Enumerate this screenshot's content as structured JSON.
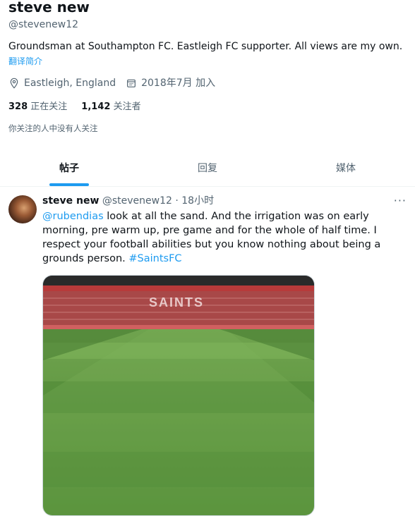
{
  "profile": {
    "display_name": "steve new",
    "handle": "@stevenew12",
    "bio": "Groundsman at Southampton FC. Eastleigh FC supporter. All views are my own.",
    "translate_bio": "翻译简介",
    "location": "Eastleigh, England",
    "joined": "2018年7月 加入",
    "following_count": "328",
    "following_label": "正在关注",
    "followers_count": "1,142",
    "followers_label": "关注者",
    "followers_you_know": "你关注的人中没有人关注"
  },
  "tabs": [
    {
      "label": "帖子",
      "active": true
    },
    {
      "label": "回复",
      "active": false
    },
    {
      "label": "媒体",
      "active": false
    }
  ],
  "tweet": {
    "name": "steve new",
    "handle_time": "@stevenew12 · 18小时",
    "more": "···",
    "mention": "@rubendias",
    "text": " look at all the sand. And the irrigation was on early morning, pre warm up, pre game and for the whole of half time. I respect your football abilities but you know nothing about being a grounds person.",
    "hashtag": "#SaintsFC",
    "stand_lettering": "SAINTS"
  },
  "colors": {
    "accent": "#1d9bf0",
    "text_primary": "#0f1419",
    "text_secondary": "#536471"
  },
  "icons": [
    "location-pin-icon",
    "calendar-icon",
    "more-options-icon"
  ]
}
